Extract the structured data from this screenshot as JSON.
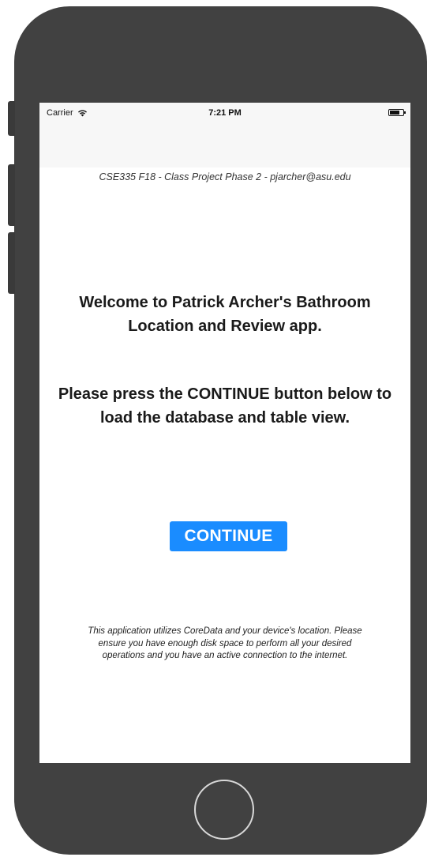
{
  "status_bar": {
    "carrier": "Carrier",
    "wifi_icon": "wifi-icon",
    "time": "7:21 PM",
    "battery_icon": "battery-icon"
  },
  "header": {
    "text": "CSE335 F18 - Class Project Phase 2 - pjarcher@asu.edu"
  },
  "welcome": {
    "text": "Welcome to Patrick Archer's Bathroom Location and Review app."
  },
  "instruction": {
    "text": "Please press the CONTINUE button below to load the database and table view."
  },
  "continue_button": {
    "label": "CONTINUE",
    "color": "#1a8cff"
  },
  "footer": {
    "text": "This application utilizes CoreData and your device's location. Please ensure you have enough disk space to perform all your desired operations and you have an active connection to the internet."
  },
  "device": {
    "frame_color": "#414141",
    "home_button_icon": "home-button-icon"
  }
}
